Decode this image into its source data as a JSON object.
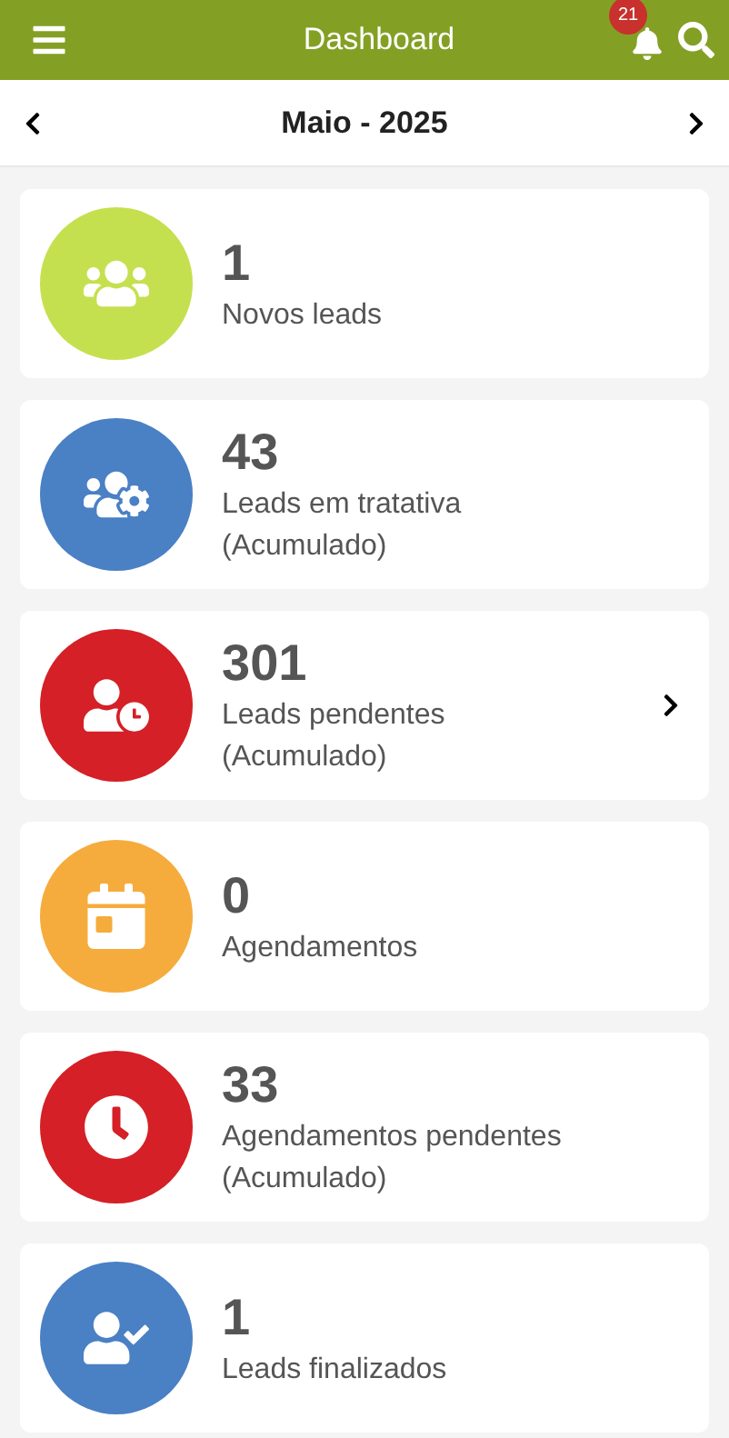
{
  "header": {
    "title": "Dashboard",
    "notification_count": "21"
  },
  "period": {
    "label": "Maio - 2025"
  },
  "cards": [
    {
      "color": "#c5e04f",
      "value": "1",
      "label": "Novos leads",
      "has_chevron": false
    },
    {
      "color": "#4a80c4",
      "value": "43",
      "label": "Leads em tratativa",
      "note": "(Acumulado)",
      "has_chevron": false
    },
    {
      "color": "#d42026",
      "value": "301",
      "label": "Leads pendentes",
      "note": "(Acumulado)",
      "has_chevron": true
    },
    {
      "color": "#f5ac3d",
      "value": "0",
      "label": "Agendamentos",
      "has_chevron": false
    },
    {
      "color": "#d42026",
      "value": "33",
      "label": "Agendamentos pendentes",
      "note": "(Acumulado)",
      "has_chevron": false
    },
    {
      "color": "#4a80c4",
      "value": "1",
      "label": "Leads finalizados",
      "has_chevron": false
    }
  ]
}
